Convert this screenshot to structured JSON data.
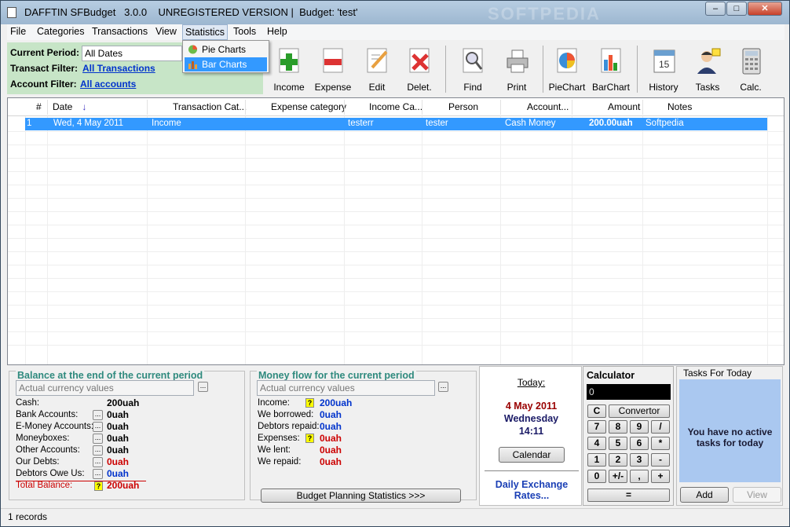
{
  "window": {
    "title": "DAFFTIN SFBudget   3.0.0    UNREGISTERED VERSION |  Budget: 'test'",
    "watermark": "SOFTPEDIA"
  },
  "menu": [
    "File",
    "Categories",
    "Transactions",
    "View",
    "Statistics",
    "Tools",
    "Help"
  ],
  "statistics_menu": {
    "items": [
      "Pie Charts",
      "Bar Charts"
    ],
    "selected": "Bar Charts"
  },
  "filters": {
    "current_period_label": "Current Period:",
    "current_period_value": "All Dates",
    "transact_filter_label": "Transact Filter:",
    "transact_filter_value": "All Transactions",
    "account_filter_label": "Account Filter:",
    "account_filter_value": "All accounts"
  },
  "toolbar": {
    "income": "Income",
    "expense": "Expense",
    "edit": "Edit",
    "delete": "Delet.",
    "find": "Find",
    "print": "Print",
    "piechart": "PieChart",
    "barchart": "BarChart",
    "history": "History",
    "tasks": "Tasks",
    "calc": "Calc."
  },
  "grid": {
    "headers": [
      "#",
      "Date",
      "Transaction Cat...",
      "Expense category",
      "Income Ca...",
      "Person",
      "Account...",
      "Amount",
      "Notes"
    ],
    "rows": [
      {
        "num": "1",
        "date": "Wed, 4 May 2011",
        "transaction_category": "Income",
        "expense_category": "",
        "income_category": "testerr",
        "person": "tester",
        "account": "Cash Money",
        "amount": "200.00uah",
        "notes": "Softpedia"
      }
    ]
  },
  "balance": {
    "title": "Balance at the end of the current period",
    "currency_select": "Actual currency values",
    "cash_label": "Cash:",
    "cash_value": "200uah",
    "bank_label": "Bank Accounts:",
    "bank_value": "0uah",
    "emoney_label": "E-Money Accounts:",
    "emoney_value": "0uah",
    "moneybox_label": "Moneyboxes:",
    "moneybox_value": "0uah",
    "other_label": "Other Accounts:",
    "other_value": "0uah",
    "debts_label": "Our Debts:",
    "debts_value": "0uah",
    "debtors_label": "Debtors Owe Us:",
    "debtors_value": "0uah",
    "total_label": "Total Balance:",
    "total_value": "200uah"
  },
  "moneyflow": {
    "title": "Money flow for the current period",
    "currency_select": "Actual currency values",
    "income_label": "Income:",
    "income_value": "200uah",
    "borrowed_label": "We borrowed:",
    "borrowed_value": "0uah",
    "debtors_repaid_label": "Debtors repaid:",
    "debtors_repaid_value": "0uah",
    "expenses_label": "Expenses:",
    "expenses_value": "0uah",
    "lent_label": "We lent:",
    "lent_value": "0uah",
    "repaid_label": "We repaid:",
    "repaid_value": "0uah",
    "planning_button": "Budget Planning Statistics >>>"
  },
  "today": {
    "label": "Today:",
    "date": "4 May 2011",
    "weekday": "Wednesday",
    "time": "14:11",
    "calendar_button": "Calendar",
    "exchange_link": "Daily Exchange Rates..."
  },
  "calculator": {
    "title": "Calculator",
    "display": "0",
    "clear": "C",
    "convertor": "Convertor",
    "keys": [
      "7",
      "8",
      "9",
      "/",
      "4",
      "5",
      "6",
      "*",
      "1",
      "2",
      "3",
      "-",
      "0",
      "+/-",
      ",",
      "+"
    ],
    "equals": "="
  },
  "tasks": {
    "title": "Tasks For Today",
    "message": "You have no active tasks for today",
    "add_button": "Add",
    "view_button": "View"
  },
  "status": {
    "records": "1 records"
  },
  "colors": {
    "selection": "#3399ff",
    "link": "#0033cc",
    "filter_bg": "#c7e5c7",
    "section_title": "#2f8a7e",
    "value_red": "#cc0000",
    "value_blue": "#0033cc",
    "tasks_bg": "#aac8f0"
  }
}
